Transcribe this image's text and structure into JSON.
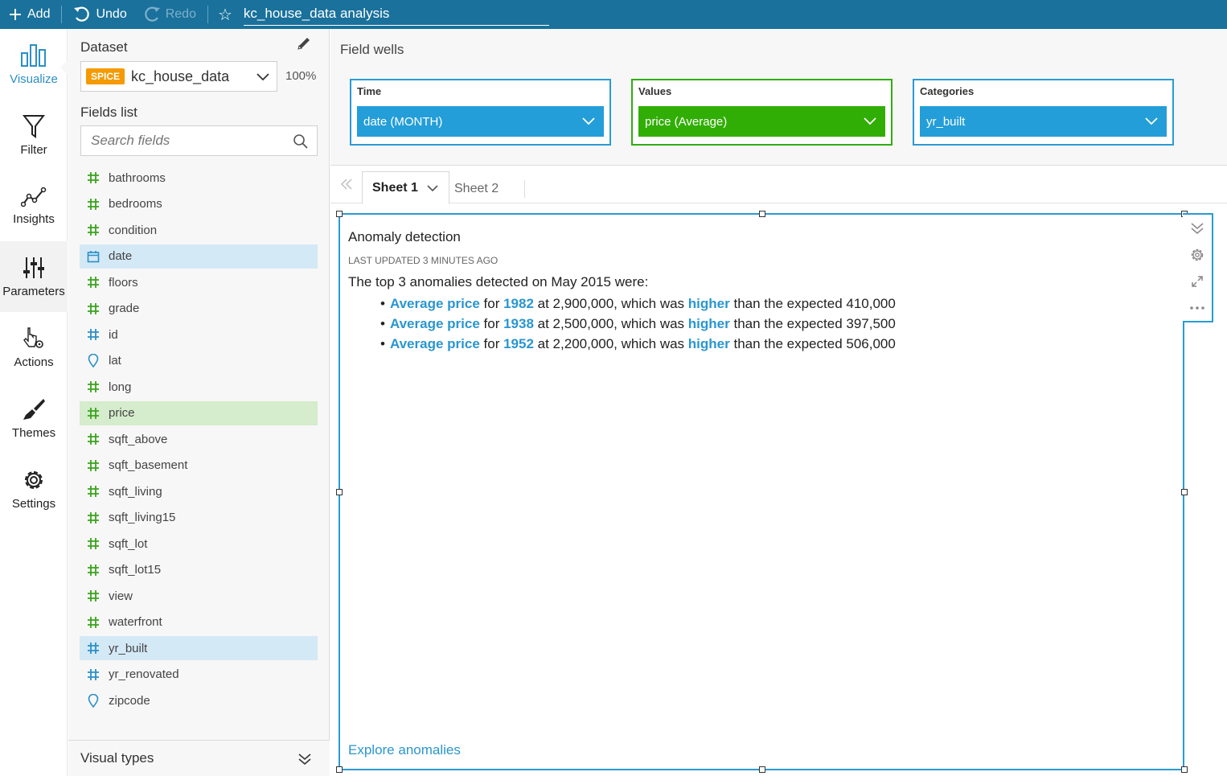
{
  "topbar": {
    "add_label": "Add",
    "undo_label": "Undo",
    "redo_label": "Redo",
    "analysis_title": "kc_house_data analysis"
  },
  "rail": {
    "items": [
      {
        "label": "Visualize",
        "icon": "bar-chart-icon"
      },
      {
        "label": "Filter",
        "icon": "funnel-icon"
      },
      {
        "label": "Insights",
        "icon": "line-chart-icon"
      },
      {
        "label": "Parameters",
        "icon": "sliders-icon"
      },
      {
        "label": "Actions",
        "icon": "cursor-gear-icon"
      },
      {
        "label": "Themes",
        "icon": "brush-icon"
      },
      {
        "label": "Settings",
        "icon": "gear-icon"
      }
    ]
  },
  "panel": {
    "dataset_label": "Dataset",
    "spice_badge": "SPICE",
    "dataset_name": "kc_house_data",
    "spice_percent": "100%",
    "fields_list_label": "Fields list",
    "search_placeholder": "Search fields",
    "fields": [
      {
        "name": "bathrooms",
        "type": "number",
        "state": ""
      },
      {
        "name": "bedrooms",
        "type": "number",
        "state": ""
      },
      {
        "name": "condition",
        "type": "number",
        "state": ""
      },
      {
        "name": "date",
        "type": "date",
        "state": "blue"
      },
      {
        "name": "floors",
        "type": "number",
        "state": ""
      },
      {
        "name": "grade",
        "type": "number",
        "state": ""
      },
      {
        "name": "id",
        "type": "id",
        "state": ""
      },
      {
        "name": "lat",
        "type": "geo",
        "state": ""
      },
      {
        "name": "long",
        "type": "number",
        "state": ""
      },
      {
        "name": "price",
        "type": "number",
        "state": "green"
      },
      {
        "name": "sqft_above",
        "type": "number",
        "state": ""
      },
      {
        "name": "sqft_basement",
        "type": "number",
        "state": ""
      },
      {
        "name": "sqft_living",
        "type": "number",
        "state": ""
      },
      {
        "name": "sqft_living15",
        "type": "number",
        "state": ""
      },
      {
        "name": "sqft_lot",
        "type": "number",
        "state": ""
      },
      {
        "name": "sqft_lot15",
        "type": "number",
        "state": ""
      },
      {
        "name": "view",
        "type": "number",
        "state": ""
      },
      {
        "name": "waterfront",
        "type": "number",
        "state": ""
      },
      {
        "name": "yr_built",
        "type": "id",
        "state": "blue"
      },
      {
        "name": "yr_renovated",
        "type": "id",
        "state": ""
      },
      {
        "name": "zipcode",
        "type": "geo",
        "state": ""
      }
    ],
    "visual_types_label": "Visual types"
  },
  "wells": {
    "title": "Field wells",
    "time": {
      "label": "Time",
      "value": "date (MONTH)"
    },
    "values": {
      "label": "Values",
      "value": "price (Average)"
    },
    "categories": {
      "label": "Categories",
      "value": "yr_built"
    }
  },
  "tabs": {
    "sheet1": "Sheet 1",
    "sheet2": "Sheet 2"
  },
  "visual": {
    "title": "Anomaly detection",
    "updated": "LAST UPDATED 3 MINUTES AGO",
    "intro": "The top 3 anomalies detected on May 2015 were:",
    "anomalies": [
      {
        "metric": "Average price",
        "for": "for",
        "year": "1982",
        "at": "at 2,900,000, which was",
        "dir": "higher",
        "expected": "than the expected 410,000"
      },
      {
        "metric": "Average price",
        "for": "for",
        "year": "1938",
        "at": "at 2,500,000, which was",
        "dir": "higher",
        "expected": "than the expected 397,500"
      },
      {
        "metric": "Average price",
        "for": "for",
        "year": "1952",
        "at": "at 2,200,000, which was",
        "dir": "higher",
        "expected": "than the expected 506,000"
      }
    ],
    "explore_link": "Explore anomalies"
  },
  "colors": {
    "topbar": "#19719c",
    "accent_blue": "#249ed8",
    "accent_green": "#31ae05",
    "spice_orange": "#f59a00"
  }
}
